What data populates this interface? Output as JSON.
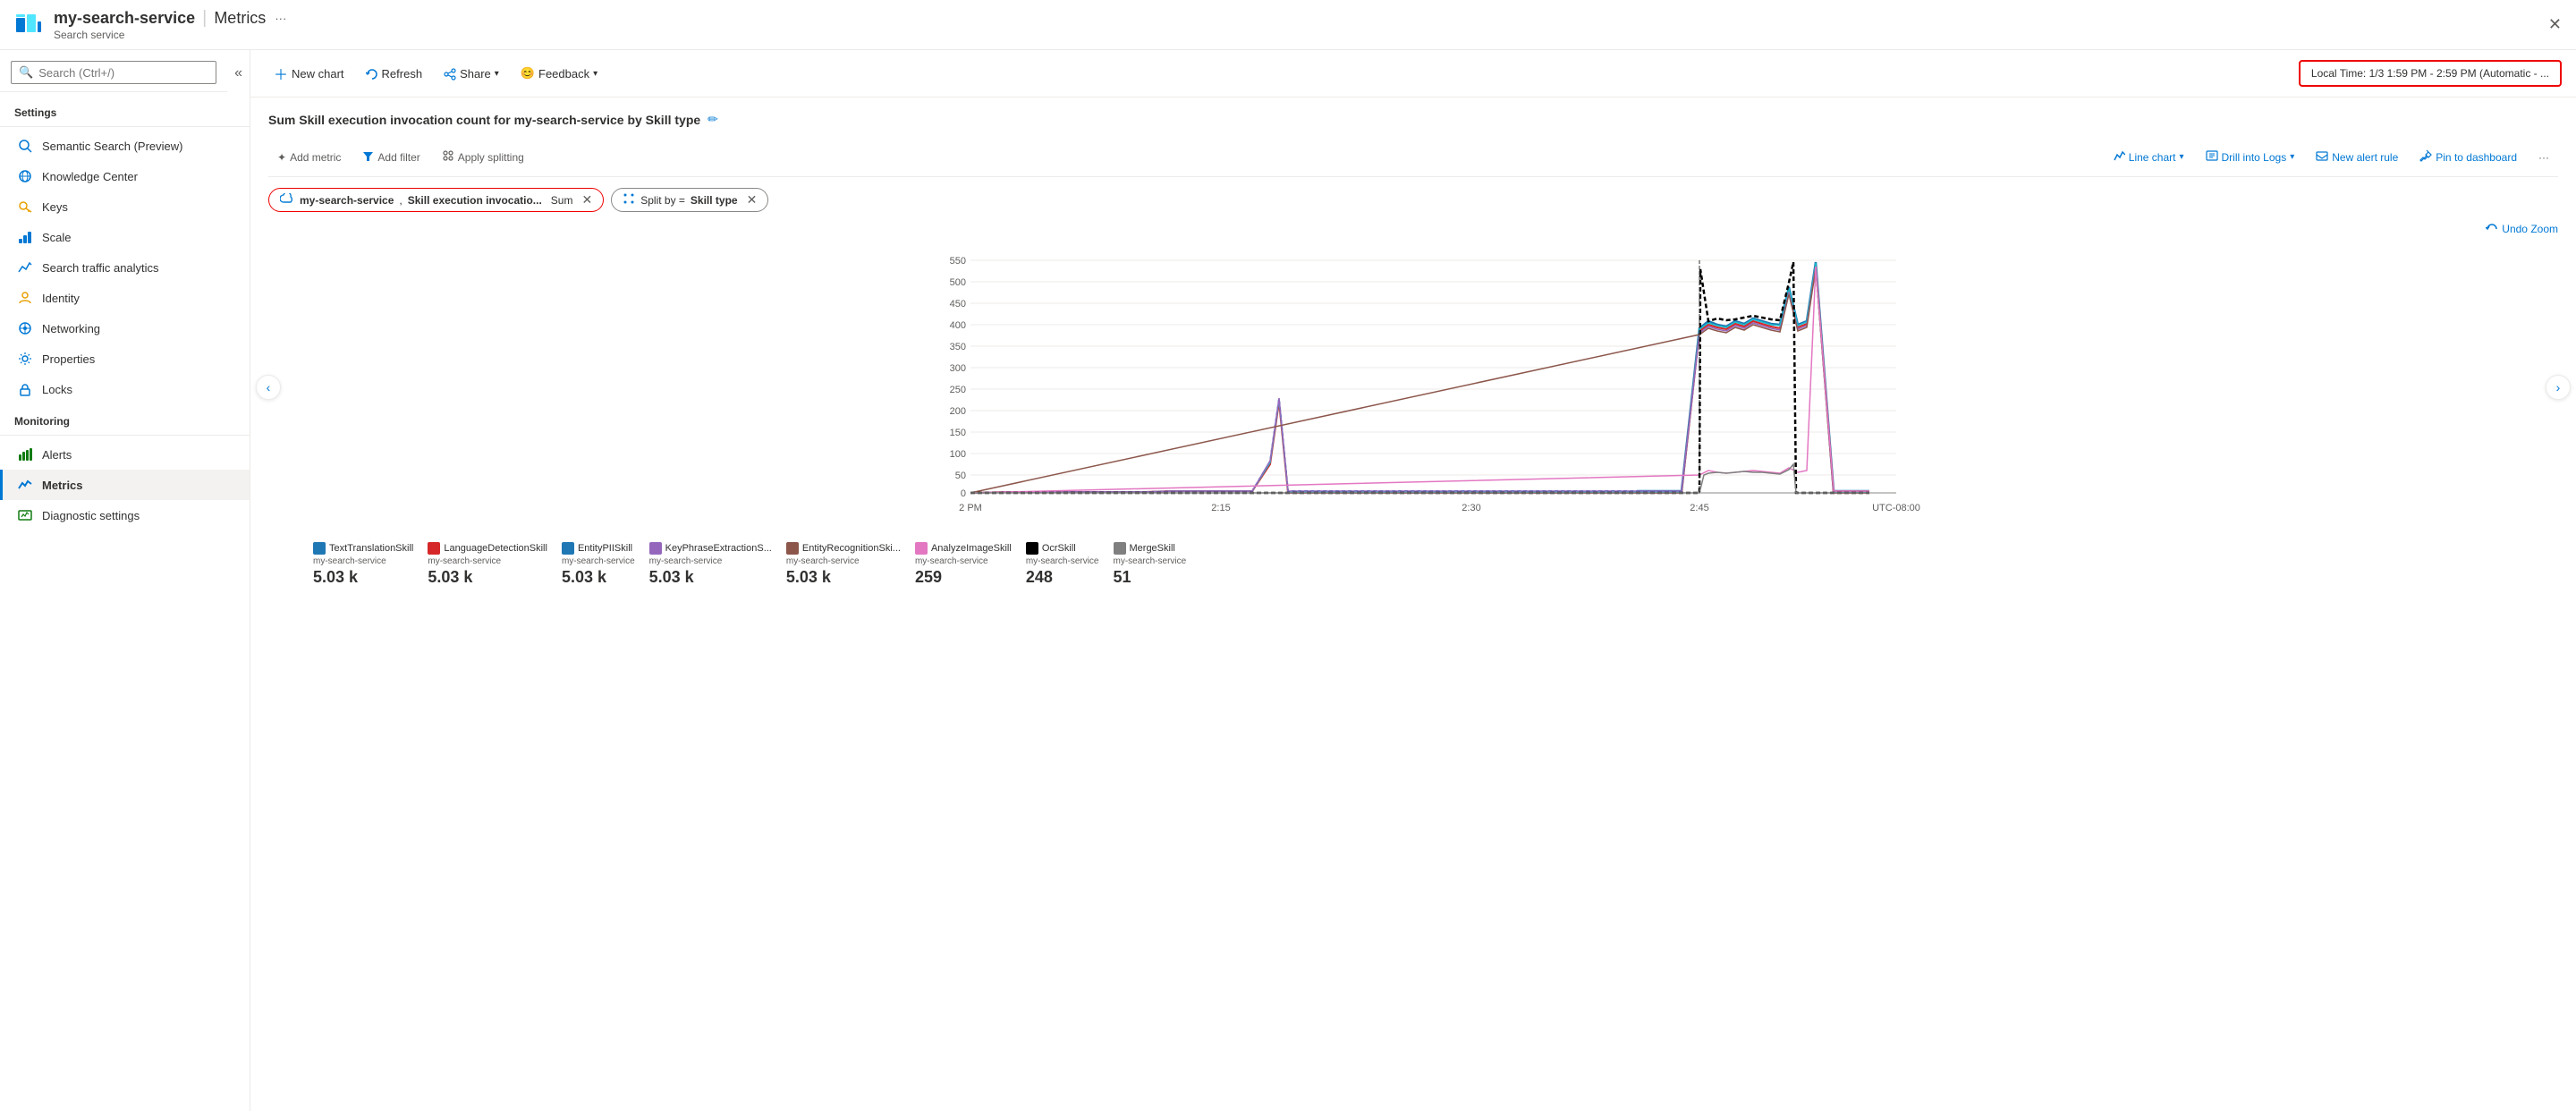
{
  "header": {
    "service_name": "my-search-service",
    "separator": "|",
    "page_title": "Metrics",
    "subtitle": "Search service",
    "ellipsis": "···",
    "close_label": "✕"
  },
  "sidebar": {
    "search_placeholder": "Search (Ctrl+/)",
    "collapse_icon": "«",
    "sections": [
      {
        "label": "Settings",
        "items": [
          {
            "id": "semantic-search",
            "label": "Semantic Search (Preview)",
            "icon": "🔍"
          },
          {
            "id": "knowledge-center",
            "label": "Knowledge Center",
            "icon": "🌐"
          },
          {
            "id": "keys",
            "label": "Keys",
            "icon": "🔑"
          },
          {
            "id": "scale",
            "label": "Scale",
            "icon": "📋"
          },
          {
            "id": "search-traffic",
            "label": "Search traffic analytics",
            "icon": "📊"
          },
          {
            "id": "identity",
            "label": "Identity",
            "icon": "🔐"
          },
          {
            "id": "networking",
            "label": "Networking",
            "icon": "🌐"
          },
          {
            "id": "properties",
            "label": "Properties",
            "icon": "⚙"
          },
          {
            "id": "locks",
            "label": "Locks",
            "icon": "🔒"
          }
        ]
      },
      {
        "label": "Monitoring",
        "items": [
          {
            "id": "alerts",
            "label": "Alerts",
            "icon": "🔔"
          },
          {
            "id": "metrics",
            "label": "Metrics",
            "icon": "📈",
            "active": true
          },
          {
            "id": "diagnostic",
            "label": "Diagnostic settings",
            "icon": "📋"
          }
        ]
      }
    ]
  },
  "toolbar": {
    "new_chart": "New chart",
    "refresh": "Refresh",
    "share": "Share",
    "feedback": "Feedback",
    "time_range": "Local Time: 1/3 1:59 PM - 2:59 PM (Automatic - ..."
  },
  "chart": {
    "title": "Sum Skill execution invocation count for my-search-service by Skill type",
    "edit_icon": "✏",
    "toolbar": {
      "add_metric": "Add metric",
      "add_filter": "Add filter",
      "apply_splitting": "Apply splitting",
      "line_chart": "Line chart",
      "drill_logs": "Drill into Logs",
      "new_alert": "New alert rule",
      "pin_dashboard": "Pin to dashboard",
      "more": "···",
      "undo_zoom": "Undo Zoom"
    },
    "metric_tag": {
      "service": "my-search-service",
      "metric": "Skill execution invocatio...",
      "aggregation": "Sum"
    },
    "split_tag": {
      "label": "Split by =",
      "value": "Skill type"
    },
    "y_axis": [
      "550",
      "500",
      "450",
      "400",
      "350",
      "300",
      "250",
      "200",
      "150",
      "100",
      "50",
      "0"
    ],
    "x_axis": [
      "2 PM",
      "2:15",
      "2:30",
      "2:45",
      "UTC-08:00"
    ],
    "legend": [
      {
        "id": "text-translation",
        "label": "TextTranslationSkill",
        "service": "my-search-service",
        "value": "5.03 k",
        "color": "#1f77b4"
      },
      {
        "id": "language-detection",
        "label": "LanguageDetectionSkill",
        "service": "my-search-service",
        "value": "5.03 k",
        "color": "#d62728"
      },
      {
        "id": "entity-pii",
        "label": "EntityPIISkill",
        "service": "my-search-service",
        "value": "5.03 k",
        "color": "#1f77b4"
      },
      {
        "id": "key-phrase",
        "label": "KeyPhraseExtractionS...",
        "service": "my-search-service",
        "value": "5.03 k",
        "color": "#9467bd"
      },
      {
        "id": "entity-recognition",
        "label": "EntityRecognitionSki...",
        "service": "my-search-service",
        "value": "5.03 k",
        "color": "#8c564b"
      },
      {
        "id": "analyze-image",
        "label": "AnalyzeImageSkill",
        "service": "my-search-service",
        "value": "259",
        "color": "#e377c2"
      },
      {
        "id": "ocr",
        "label": "OcrSkill",
        "service": "my-search-service",
        "value": "248",
        "color": "#000000"
      },
      {
        "id": "merge",
        "label": "MergeSkill",
        "service": "my-search-service",
        "value": "51",
        "color": "#7f7f7f"
      }
    ]
  }
}
